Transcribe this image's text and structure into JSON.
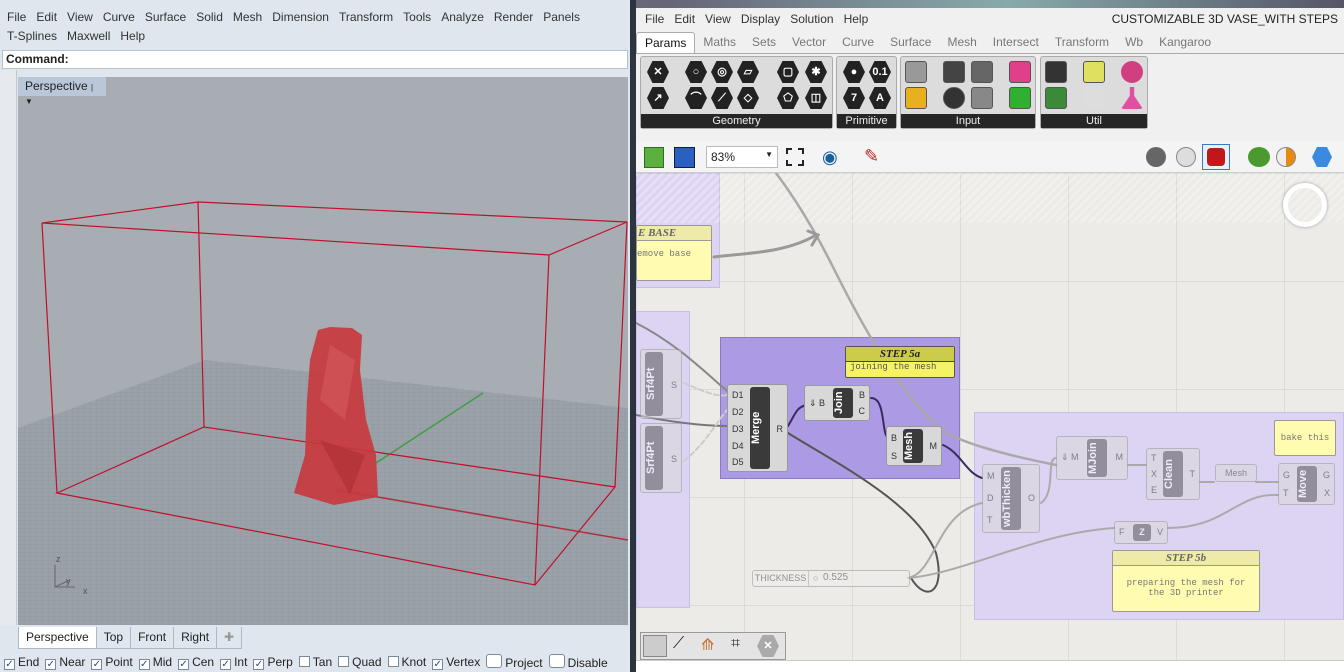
{
  "rhino": {
    "menu_row1": [
      "File",
      "Edit",
      "View",
      "Curve",
      "Surface",
      "Solid",
      "Mesh",
      "Dimension",
      "Transform",
      "Tools",
      "Analyze",
      "Render",
      "Panels"
    ],
    "menu_row2": [
      "T-Splines",
      "Maxwell",
      "Help"
    ],
    "command_label": "Command:",
    "viewport_title": "Perspective",
    "viewport_tabs": [
      "Perspective",
      "Top",
      "Front",
      "Right"
    ],
    "axis_labels": {
      "z": "z",
      "y": "y",
      "x": "x"
    },
    "osnaps": [
      {
        "label": "End",
        "checked": true
      },
      {
        "label": "Near",
        "checked": true
      },
      {
        "label": "Point",
        "checked": true
      },
      {
        "label": "Mid",
        "checked": true
      },
      {
        "label": "Cen",
        "checked": true
      },
      {
        "label": "Int",
        "checked": true
      },
      {
        "label": "Perp",
        "checked": true
      },
      {
        "label": "Tan",
        "checked": false
      },
      {
        "label": "Quad",
        "checked": false
      },
      {
        "label": "Knot",
        "checked": false
      },
      {
        "label": "Vertex",
        "checked": true
      },
      {
        "label": "Project",
        "checked": false
      },
      {
        "label": "Disable",
        "checked": false
      }
    ],
    "colors": {
      "bbox": "#c0102a",
      "object": "#c8383e",
      "y_axis": "#3aa040",
      "x_axis": "#b03040"
    }
  },
  "gh": {
    "menu": [
      "File",
      "Edit",
      "View",
      "Display",
      "Solution",
      "Help"
    ],
    "doc_title": "CUSTOMIZABLE 3D VASE_WITH STEPS",
    "tabs": [
      "Params",
      "Maths",
      "Sets",
      "Vector",
      "Curve",
      "Surface",
      "Mesh",
      "Intersect",
      "Transform",
      "Wb",
      "Kangaroo"
    ],
    "active_tab": "Params",
    "panels": [
      "Geometry",
      "Primitive",
      "Input",
      "Util"
    ],
    "zoom": "83%",
    "nodes": {
      "srf1": "Srf4Pt",
      "srf2": "Srf4Pt",
      "merge": "Merge",
      "join": "Join",
      "mesh": "Mesh",
      "thicken": "wbThicken",
      "mjoin": "MJoin",
      "clean": "Clean",
      "mesh_param": "Mesh",
      "move": "Move",
      "z": "Z"
    },
    "notes": {
      "base_title": "E BASE",
      "base_text": "emove base",
      "step5a_title": "STEP 5a",
      "step5a_text": "joining the mesh",
      "step5b_title": "STEP 5b",
      "step5b_text": "preparing the mesh for the 3D printer",
      "bake_text": "bake this"
    },
    "slider": {
      "label": "THICKNESS",
      "value": "0.525"
    },
    "colors": {
      "group_dark": "#ad9ae4",
      "group_light": "#ddd4f4",
      "note_header": "#cccb4a",
      "note_body": "#f5f266"
    }
  }
}
